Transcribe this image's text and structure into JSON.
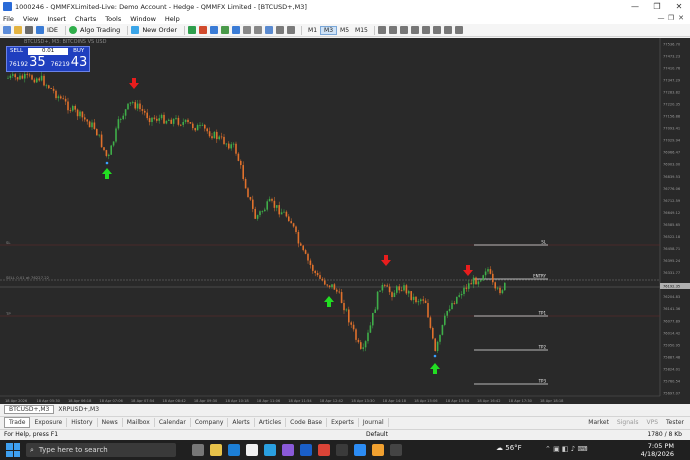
{
  "window": {
    "title": "1000246 - QMMFXLimited-Live: Demo Account - Hedge - QMMFX Limited - [BTCUSD+,M3]",
    "buttons": [
      "—",
      "❐",
      "✕"
    ]
  },
  "menu": {
    "items": [
      "File",
      "View",
      "Insert",
      "Charts",
      "Tools",
      "Window",
      "Help"
    ],
    "right_controls": [
      "—",
      "❐",
      "✕"
    ]
  },
  "toolbar": {
    "ide_label": "IDE",
    "algo_label": "Algo Trading",
    "new_order_label": "New Order",
    "timeframes": [
      "M1",
      "M3",
      "M5",
      "M15"
    ],
    "active_timeframe": "M3"
  },
  "trade_panel": {
    "sell_label": "SELL",
    "buy_label": "BUY",
    "volume": "0.01",
    "sell_price_small": "76192",
    "sell_price_big": "35",
    "buy_price_small": "76219",
    "buy_price_big": "43"
  },
  "chart": {
    "symbol_label": "BTCUSD+, M3:  BITCOINS VS USD",
    "order_line_label": "SELL 0.01 at 76227.22",
    "sl_label": "SL",
    "tp_left_label": "TP",
    "levels": {
      "sl": "SL",
      "entry": "ENTRY",
      "tp1": "TP1",
      "tp2": "TP2",
      "tp3": "TP3"
    },
    "price_ticks": [
      "77536.70",
      "77473.23",
      "77410.76",
      "77347.29",
      "77283.82",
      "77220.35",
      "77156.88",
      "77093.41",
      "77029.94",
      "76966.47",
      "76903.00",
      "76839.53",
      "76776.06",
      "76712.59",
      "76649.12",
      "76585.65",
      "76522.18",
      "76458.71",
      "76395.24",
      "76331.77",
      "76268.30",
      "76204.83",
      "76141.36",
      "76077.89",
      "76014.42",
      "75950.95",
      "75887.48",
      "75824.01",
      "75760.54",
      "75697.07"
    ],
    "current_price": "76192.35",
    "time_ticks": [
      "18 Apr 2026",
      "18 Apr 05:30",
      "18 Apr 06:18",
      "18 Apr 07:06",
      "18 Apr 07:54",
      "18 Apr 08:42",
      "18 Apr 09:30",
      "18 Apr 10:18",
      "18 Apr 11:06",
      "18 Apr 11:54",
      "18 Apr 12:42",
      "18 Apr 13:30",
      "18 Apr 14:18",
      "18 Apr 15:06",
      "18 Apr 15:54",
      "18 Apr 16:42",
      "18 Apr 17:30",
      "18 Apr 18:18"
    ],
    "colors": {
      "background": "#292929",
      "bull": "#3fae49",
      "bear": "#e0712c",
      "sell_arrow": "#e81d1d",
      "buy_arrow": "#22dd22"
    }
  },
  "chart_tabs": [
    "BTCUSD+,M3",
    "XRPUSD+,M3"
  ],
  "toolbox_tabs": [
    "Trade",
    "Exposure",
    "History",
    "News",
    "Mailbox",
    "Calendar",
    "Company",
    "Alerts",
    "Articles",
    "Code Base",
    "Experts",
    "Journal"
  ],
  "toolbox_right": {
    "market": "Market",
    "signals": "Signals",
    "vps": "VPS",
    "tester": "Tester"
  },
  "status": {
    "help": "For Help, press F1",
    "profile": "Default",
    "connection": "1780 / 8 Kb"
  },
  "taskbar": {
    "search_placeholder": "Type here to search",
    "weather": "56°F",
    "time": "7:05 PM",
    "date": "4/18/2026"
  }
}
